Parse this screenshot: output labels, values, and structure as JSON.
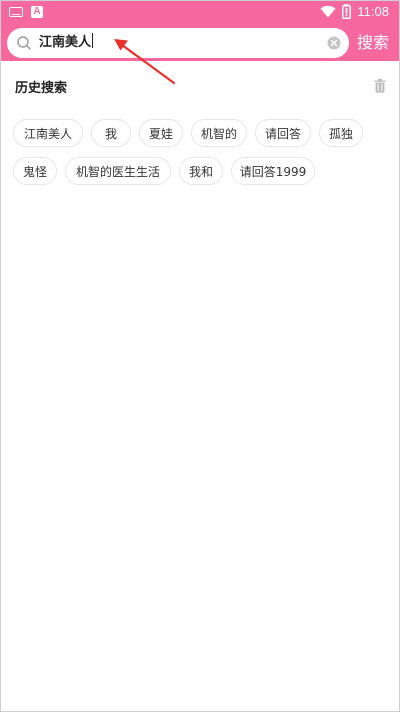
{
  "status_bar": {
    "time": "11:08",
    "icons": [
      "keyboard-icon",
      "app-a-icon",
      "wifi-icon",
      "battery-icon"
    ]
  },
  "search": {
    "value": "江南美人",
    "button_label": "搜索"
  },
  "history": {
    "title": "历史搜索",
    "tags": [
      "江南美人",
      "我",
      "夏娃",
      "机智的",
      "请回答",
      "孤独",
      "鬼怪",
      "机智的医生生活",
      "我和",
      "请回答1999"
    ]
  },
  "colors": {
    "accent": "#f7699e",
    "annotation_arrow": "#e8302a"
  }
}
